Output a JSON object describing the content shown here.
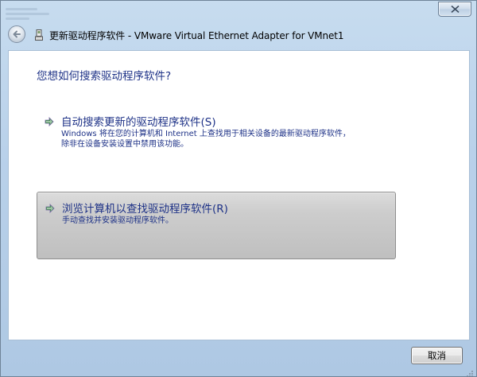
{
  "window": {
    "title": "更新驱动程序软件 - VMware Virtual Ethernet Adapter for VMnet1",
    "close_icon": "close-icon",
    "back_icon": "back-arrow-icon",
    "driver_icon": "driver-device-icon"
  },
  "main": {
    "question": "您想如何搜索驱动程序软件?",
    "options": [
      {
        "icon": "green-arrow-icon",
        "title": "自动搜索更新的驱动程序软件(S)",
        "description_line1": "Windows 将在您的计算机和 Internet 上查找用于相关设备的最新驱动程序软件，",
        "description_line2": "除非在设备安装设置中禁用该功能。",
        "hovered": false
      },
      {
        "icon": "green-arrow-icon",
        "title": "浏览计算机以查找驱动程序软件(R)",
        "description_line1": "手动查找并安装驱动程序软件。",
        "hovered": true
      }
    ]
  },
  "footer": {
    "cancel_label": "取消"
  },
  "colors": {
    "link_blue": "#1e3287",
    "frame": "#b9d1ea",
    "arrow_green": "#2f9b2f"
  }
}
